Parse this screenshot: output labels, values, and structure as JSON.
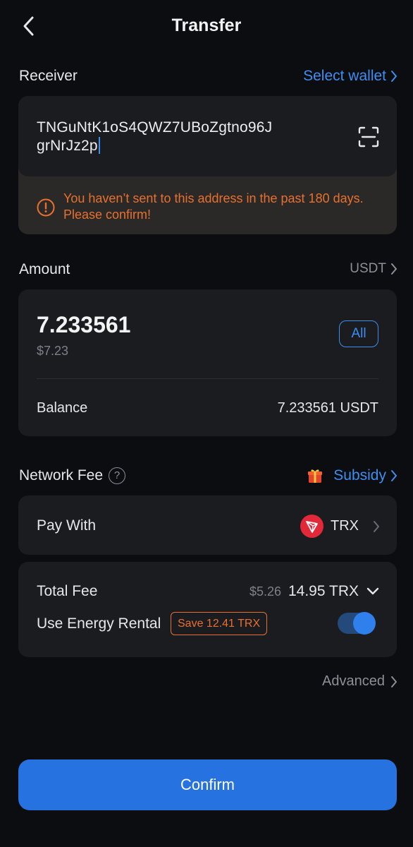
{
  "header": {
    "title": "Transfer"
  },
  "receiver": {
    "label": "Receiver",
    "select_wallet": "Select wallet",
    "address_line1": "TNGuNtK1oS4QWZ7UBoZgtno96J",
    "address_line2": "grNrJz2p",
    "warning": "You haven’t sent to this address in the past 180 days. Please confirm!"
  },
  "amount": {
    "label": "Amount",
    "token": "USDT",
    "value": "7.233561",
    "fiat": "$7.23",
    "all_label": "All",
    "balance_label": "Balance",
    "balance_value": "7.233561 USDT"
  },
  "network_fee": {
    "label": "Network Fee",
    "help": "?",
    "subsidy_label": "Subsidy",
    "pay_with_label": "Pay With",
    "pay_with_token": "TRX",
    "total_fee_label": "Total Fee",
    "total_fee_fiat": "$5.26",
    "total_fee_trx": "14.95 TRX",
    "energy_label": "Use Energy Rental",
    "save_badge": "Save 12.41 TRX",
    "energy_enabled": true
  },
  "advanced_label": "Advanced",
  "confirm_label": "Confirm",
  "colors": {
    "accent": "#3d8ef0",
    "warning": "#e8702f",
    "primary_button": "#2572e0",
    "tron_red": "#e2293a"
  },
  "icons": {
    "back": "chevron-left-icon",
    "scan": "scan-icon",
    "warning": "alert-circle-icon",
    "gift": "gift-icon",
    "tron": "tron-logo-icon",
    "chevron": "chevron-right-icon",
    "expand": "chevron-down-icon"
  }
}
